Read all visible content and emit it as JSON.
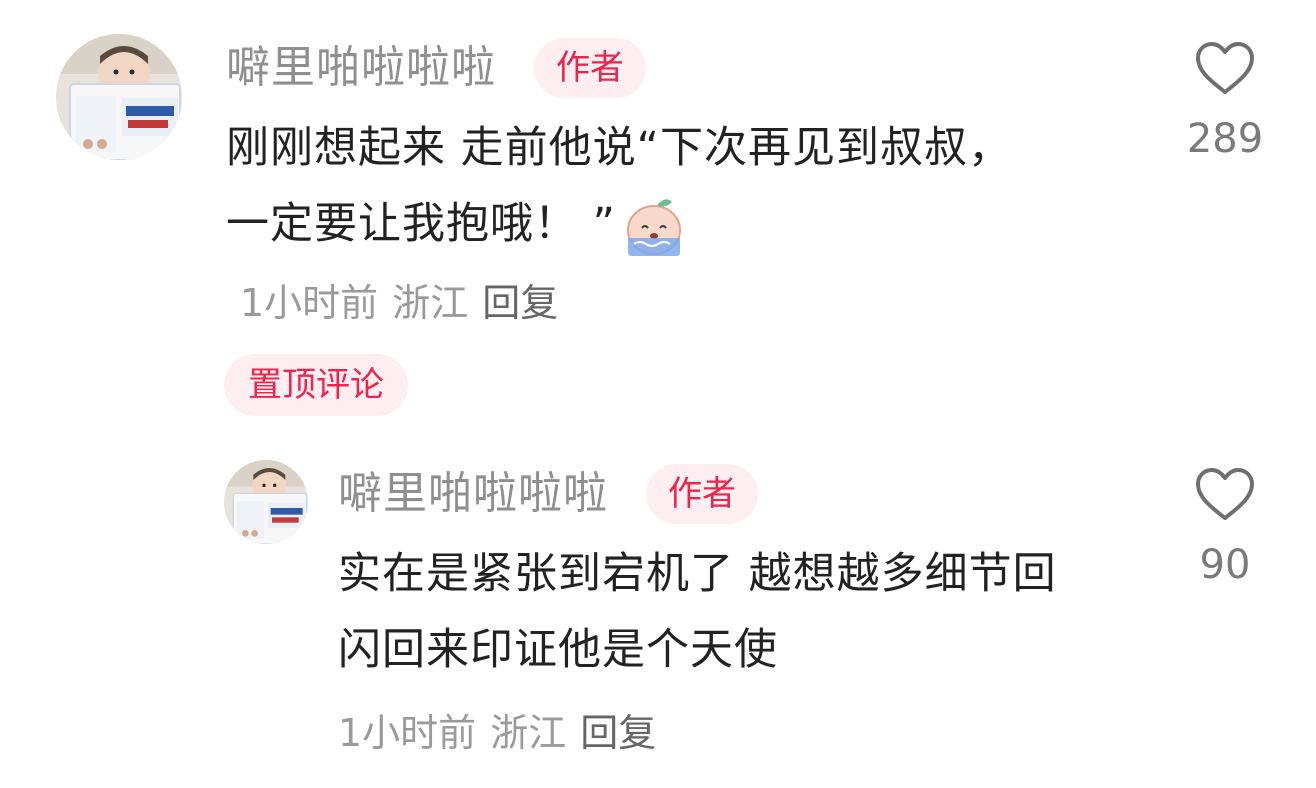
{
  "comments": [
    {
      "username": "噼里啪啦啦啦",
      "badge": "作者",
      "text_line1": "刚刚想起来 走前他说“下次再见到叔叔，",
      "text_line2": "一定要让我抱哦！ ”",
      "emoji": "crying-peach-emoji",
      "time": "1小时前",
      "location": "浙江",
      "reply_label": "回复",
      "pinned_label": "置顶评论",
      "like_count": "289",
      "replies": [
        {
          "username": "噼里啪啦啦啦",
          "badge": "作者",
          "text_line1": "实在是紧张到宕机了 越想越多细节回",
          "text_line2": "闪回来印证他是个天使",
          "time": "1小时前",
          "location": "浙江",
          "reply_label": "回复",
          "like_count": "90"
        }
      ]
    }
  ],
  "colors": {
    "accent": "#f0234b",
    "badge_bg": "#fdeef1",
    "username": "#8f8f8f",
    "meta": "#9a9a9a"
  },
  "icons": {
    "like": "heart-outline-icon",
    "avatar_image": "baby-reading-book"
  }
}
